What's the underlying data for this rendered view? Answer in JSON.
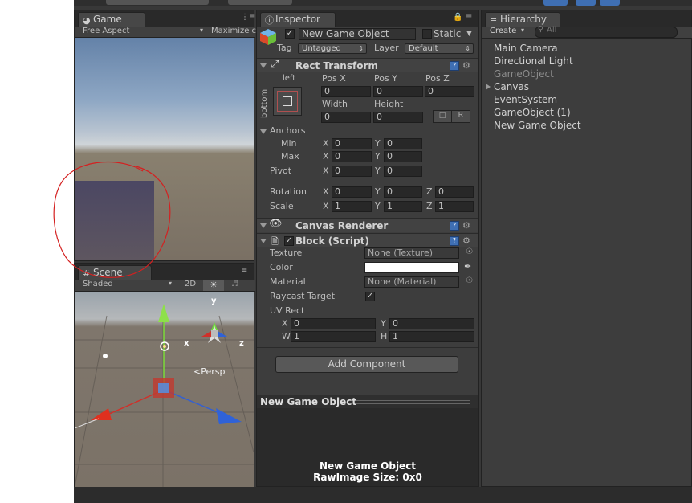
{
  "game": {
    "tab_label": "Game",
    "aspect_label": "Free Aspect",
    "maximize_label": "Maximize c"
  },
  "scene": {
    "tab_label": "Scene",
    "shading_label": "Shaded",
    "mode_2d_label": "2D",
    "persp_label": "<Persp",
    "axis_y": "y",
    "axis_x": "x",
    "axis_z": "z"
  },
  "inspector": {
    "tab_label": "Inspector",
    "object_name": "New Game Object",
    "static_label": "Static",
    "tag_label": "Tag",
    "tag_value": "Untagged",
    "layer_label": "Layer",
    "layer_value": "Default",
    "rect_transform": {
      "title": "Rect Transform",
      "anchor_left": "left",
      "anchor_bottom": "bottom",
      "pos_x_label": "Pos X",
      "pos_y_label": "Pos Y",
      "pos_z_label": "Pos Z",
      "pos_x": "0",
      "pos_y": "0",
      "pos_z": "0",
      "width_label": "Width",
      "height_label": "Height",
      "width": "0",
      "height": "0",
      "r_button": "R",
      "anchors_label": "Anchors",
      "min_label": "Min",
      "max_label": "Max",
      "min_x": "0",
      "min_y": "0",
      "max_x": "0",
      "max_y": "0",
      "pivot_label": "Pivot",
      "pivot_x": "0",
      "pivot_y": "0",
      "rotation_label": "Rotation",
      "rot_x": "0",
      "rot_y": "0",
      "rot_z": "0",
      "scale_label": "Scale",
      "scale_x": "1",
      "scale_y": "1",
      "scale_z": "1",
      "x": "X",
      "y": "Y",
      "z": "Z"
    },
    "canvas_renderer": {
      "title": "Canvas Renderer"
    },
    "block_script": {
      "title": "Block (Script)",
      "texture_label": "Texture",
      "texture_value": "None (Texture)",
      "color_label": "Color",
      "material_label": "Material",
      "material_value": "None (Material)",
      "raycast_label": "Raycast Target",
      "uv_rect_label": "UV Rect",
      "uv_x_label": "X",
      "uv_x": "0",
      "uv_y_label": "Y",
      "uv_y": "0",
      "uv_w_label": "W",
      "uv_w": "1",
      "uv_h_label": "H",
      "uv_h": "1"
    },
    "add_component_label": "Add Component",
    "preview": {
      "title": "New Game Object",
      "line1": "New Game Object",
      "line2": "RawImage Size: 0x0"
    }
  },
  "hierarchy": {
    "tab_label": "Hierarchy",
    "create_label": "Create",
    "search_placeholder": "All",
    "items": [
      "Main Camera",
      "Directional Light",
      "GameObject",
      "Canvas",
      "EventSystem",
      "GameObject (1)",
      "New Game Object"
    ]
  },
  "colors": {
    "editor_bg": "#383838",
    "annotation_red": "#d42020",
    "selection_blue": "#3f6fb3"
  }
}
